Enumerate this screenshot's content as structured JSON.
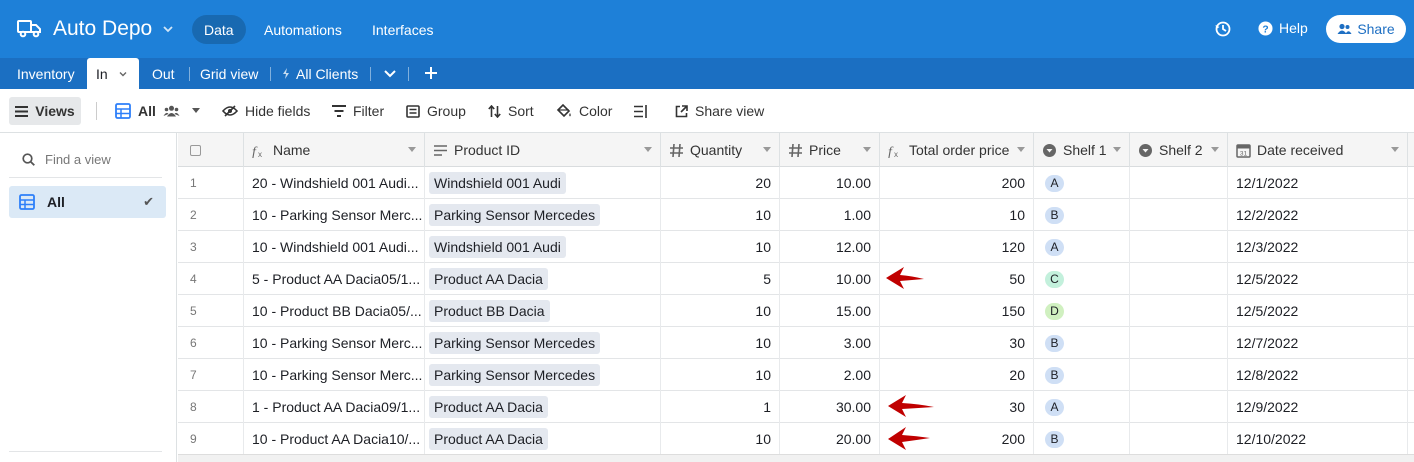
{
  "header": {
    "base_title": "Auto Depo",
    "nav": [
      "Data",
      "Automations",
      "Interfaces"
    ],
    "help_label": "Help",
    "share_label": "Share"
  },
  "tabs": {
    "items": [
      "Inventory",
      "In",
      "Out",
      "Grid view",
      "All Clients"
    ]
  },
  "toolbar": {
    "views_label": "Views",
    "view_name": "All",
    "hide_fields": "Hide fields",
    "filter": "Filter",
    "group": "Group",
    "sort": "Sort",
    "color": "Color",
    "share_view": "Share view"
  },
  "sidebar": {
    "find_placeholder": "Find a view",
    "views": [
      "All"
    ]
  },
  "table": {
    "columns": [
      "Name",
      "Product ID",
      "Quantity",
      "Price",
      "Total order price",
      "Shelf 1",
      "Shelf 2",
      "Date received"
    ],
    "rows": [
      {
        "num": "1",
        "name": "20 - Windshield 001 Audi...",
        "product": "Windshield 001 Audi",
        "qty": "20",
        "price": "10.00",
        "total": "200",
        "shelf1": "A",
        "shelf2": "",
        "date": "12/1/2022"
      },
      {
        "num": "2",
        "name": "10 - Parking Sensor Merc...",
        "product": "Parking Sensor Mercedes",
        "qty": "10",
        "price": "1.00",
        "total": "10",
        "shelf1": "B",
        "shelf2": "",
        "date": "12/2/2022"
      },
      {
        "num": "3",
        "name": "10 - Windshield 001 Audi...",
        "product": "Windshield 001 Audi",
        "qty": "10",
        "price": "12.00",
        "total": "120",
        "shelf1": "A",
        "shelf2": "",
        "date": "12/3/2022"
      },
      {
        "num": "4",
        "name": "5 - Product AA Dacia05/1...",
        "product": "Product AA Dacia",
        "qty": "5",
        "price": "10.00",
        "total": "50",
        "shelf1": "C",
        "shelf2": "",
        "date": "12/5/2022"
      },
      {
        "num": "5",
        "name": "10 - Product BB Dacia05/...",
        "product": "Product BB Dacia",
        "qty": "10",
        "price": "15.00",
        "total": "150",
        "shelf1": "D",
        "shelf2": "",
        "date": "12/5/2022"
      },
      {
        "num": "6",
        "name": "10 - Parking Sensor Merc...",
        "product": "Parking Sensor Mercedes",
        "qty": "10",
        "price": "3.00",
        "total": "30",
        "shelf1": "B",
        "shelf2": "",
        "date": "12/7/2022"
      },
      {
        "num": "7",
        "name": "10 - Parking Sensor Merc...",
        "product": "Parking Sensor Mercedes",
        "qty": "10",
        "price": "2.00",
        "total": "20",
        "shelf1": "B",
        "shelf2": "",
        "date": "12/8/2022"
      },
      {
        "num": "8",
        "name": "1 - Product AA Dacia09/1...",
        "product": "Product AA Dacia",
        "qty": "1",
        "price": "30.00",
        "total": "30",
        "shelf1": "A",
        "shelf2": "",
        "date": "12/9/2022"
      },
      {
        "num": "9",
        "name": "10 - Product AA Dacia10/...",
        "product": "Product AA Dacia",
        "qty": "10",
        "price": "20.00",
        "total": "200",
        "shelf1": "B",
        "shelf2": "",
        "date": "12/10/2022"
      }
    ]
  },
  "colors": {
    "topbar": "#1e80d8",
    "tabbar": "#1b6fc2",
    "shelf_A": "#cfdff5",
    "shelf_B": "#cfdff5",
    "shelf_C": "#c3f0dc",
    "shelf_D": "#d0f0c0",
    "annotation_arrow": "#c00000"
  },
  "annotations": {
    "arrows_pointing_at_rows": [
      "4",
      "8",
      "9"
    ]
  }
}
